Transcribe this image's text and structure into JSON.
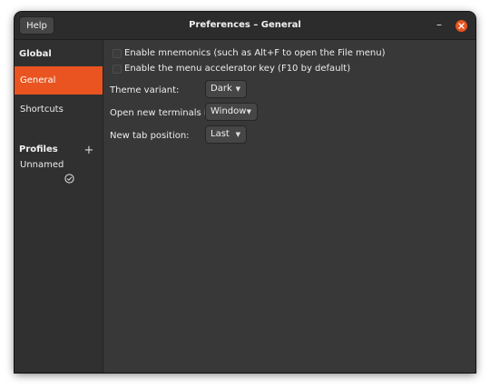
{
  "header": {
    "help_label": "Help",
    "title": "Preferences – General"
  },
  "sidebar": {
    "global_heading": "Global",
    "items": [
      {
        "label": "General",
        "selected": true
      },
      {
        "label": "Shortcuts",
        "selected": false
      }
    ],
    "profiles_heading": "Profiles",
    "profiles": [
      {
        "label": "Unnamed",
        "default": true
      }
    ]
  },
  "general": {
    "checkboxes": [
      {
        "label": "Enable mnemonics (such as Alt+F to open the File menu)",
        "checked": false
      },
      {
        "label": "Enable the menu accelerator key (F10 by default)",
        "checked": false
      }
    ],
    "settings": [
      {
        "label": "Theme variant:",
        "value": "Dark"
      },
      {
        "label": "Open new terminals in:",
        "value": "Window"
      },
      {
        "label": "New tab position:",
        "value": "Last"
      }
    ]
  },
  "colors": {
    "accent": "#e95420",
    "window_bg": "#383838",
    "sidebar_bg": "#303030",
    "headerbar_bg": "#2c2c2c"
  },
  "icons": [
    "minimize-icon",
    "close-icon",
    "add-icon",
    "check-circle-icon",
    "chevron-down-icon"
  ]
}
